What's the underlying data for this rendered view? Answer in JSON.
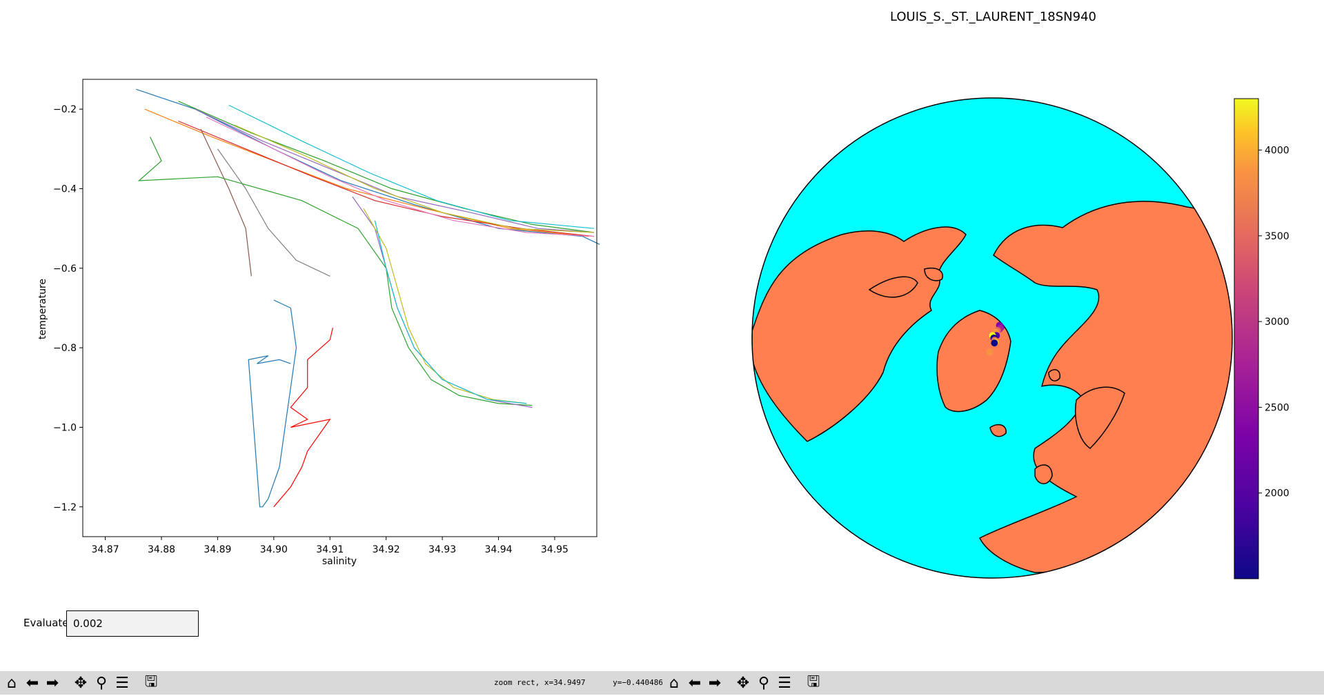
{
  "window": {
    "left_figure": {
      "chart_data": {
        "type": "line",
        "title": "",
        "xlabel": "salinity",
        "ylabel": "temperature",
        "xlim": [
          34.866,
          34.9575
        ],
        "ylim": [
          -1.275,
          -0.125
        ],
        "x_ticks": [
          34.87,
          34.88,
          34.89,
          34.9,
          34.91,
          34.92,
          34.93,
          34.94,
          34.95
        ],
        "y_ticks": [
          -0.2,
          -0.4,
          -0.6,
          -0.8,
          -1.0,
          -1.2
        ],
        "x_tick_labels": [
          "34.87",
          "34.88",
          "34.89",
          "34.90",
          "34.91",
          "34.92",
          "34.93",
          "34.94",
          "34.95"
        ],
        "y_tick_labels": [
          "−0.2",
          "−0.4",
          "−0.6",
          "−0.8",
          "−1.0",
          "−1.2"
        ],
        "grid": false,
        "series": [
          {
            "color": "#1f77b4",
            "x": [
              34.8755,
              34.886,
              34.9,
              34.912,
              34.925,
              34.94,
              34.955,
              34.958
            ],
            "y": [
              -0.15,
              -0.2,
              -0.3,
              -0.38,
              -0.44,
              -0.5,
              -0.52,
              -0.54
            ]
          },
          {
            "color": "#ff7f0e",
            "x": [
              34.877,
              34.889,
              34.9,
              34.913,
              34.927,
              34.942,
              34.956
            ],
            "y": [
              -0.2,
              -0.27,
              -0.33,
              -0.4,
              -0.45,
              -0.5,
              -0.52
            ]
          },
          {
            "color": "#2ca02c",
            "x": [
              34.883,
              34.896,
              34.909,
              34.921,
              34.934,
              34.946,
              34.957
            ],
            "y": [
              -0.18,
              -0.26,
              -0.33,
              -0.4,
              -0.45,
              -0.49,
              -0.51
            ]
          },
          {
            "color": "#d62728",
            "x": [
              34.883,
              34.895,
              34.907,
              34.918,
              34.93,
              34.944,
              34.957
            ],
            "y": [
              -0.23,
              -0.3,
              -0.37,
              -0.43,
              -0.47,
              -0.5,
              -0.52
            ]
          },
          {
            "color": "#9467bd",
            "x": [
              34.886,
              34.898,
              34.91,
              34.922,
              34.935,
              34.947,
              34.957
            ],
            "y": [
              -0.2,
              -0.28,
              -0.35,
              -0.42,
              -0.46,
              -0.5,
              -0.51
            ]
          },
          {
            "color": "#8c564b",
            "x": [
              34.887,
              34.892,
              34.895,
              34.896
            ],
            "y": [
              -0.25,
              -0.4,
              -0.5,
              -0.62
            ]
          },
          {
            "color": "#e377c2",
            "x": [
              34.888,
              34.9,
              34.91,
              34.92,
              34.932,
              34.945,
              34.957
            ],
            "y": [
              -0.22,
              -0.3,
              -0.37,
              -0.43,
              -0.48,
              -0.51,
              -0.52
            ]
          },
          {
            "color": "#7f7f7f",
            "x": [
              34.89,
              34.895,
              34.899,
              34.904,
              34.91
            ],
            "y": [
              -0.3,
              -0.4,
              -0.5,
              -0.58,
              -0.62
            ]
          },
          {
            "color": "#bcbd22",
            "x": [
              34.893,
              34.906,
              34.918,
              34.93,
              34.943,
              34.957
            ],
            "y": [
              -0.24,
              -0.32,
              -0.4,
              -0.46,
              -0.5,
              -0.51
            ]
          },
          {
            "color": "#17becf",
            "x": [
              34.892,
              34.905,
              34.917,
              34.929,
              34.942,
              34.957
            ],
            "y": [
              -0.19,
              -0.28,
              -0.36,
              -0.43,
              -0.48,
              -0.5
            ]
          },
          {
            "color": "#2ca02c",
            "x": [
              34.878,
              34.88,
              34.876,
              34.89,
              34.905,
              34.915,
              34.92,
              34.921,
              34.924,
              34.928,
              34.933,
              34.94,
              34.946
            ],
            "y": [
              -0.27,
              -0.33,
              -0.38,
              -0.37,
              -0.43,
              -0.5,
              -0.6,
              -0.7,
              -0.8,
              -0.88,
              -0.92,
              -0.94,
              -0.945
            ]
          },
          {
            "color": "#9467bd",
            "x": [
              34.914,
              34.918,
              34.92,
              34.922,
              34.925,
              34.93,
              34.938,
              34.946
            ],
            "y": [
              -0.42,
              -0.5,
              -0.6,
              -0.7,
              -0.8,
              -0.88,
              -0.93,
              -0.95
            ]
          },
          {
            "color": "#bcbd22",
            "x": [
              34.916,
              34.92,
              34.922,
              34.924,
              34.927,
              34.932,
              34.939,
              34.945
            ],
            "y": [
              -0.45,
              -0.55,
              -0.65,
              -0.75,
              -0.84,
              -0.9,
              -0.93,
              -0.94
            ]
          },
          {
            "color": "#17becf",
            "x": [
              34.918,
              34.92,
              34.922,
              34.925,
              34.93,
              34.938,
              34.945
            ],
            "y": [
              -0.48,
              -0.6,
              -0.7,
              -0.8,
              -0.88,
              -0.93,
              -0.94
            ]
          },
          {
            "color": "#1f77b4",
            "x": [
              34.9,
              34.903,
              34.904,
              34.903,
              34.902,
              34.901,
              34.9,
              34.899,
              34.898,
              34.8975,
              34.8955,
              34.899,
              34.897,
              34.901,
              34.903
            ],
            "y": [
              -0.68,
              -0.7,
              -0.8,
              -0.9,
              -1.0,
              -1.1,
              -1.14,
              -1.18,
              -1.2,
              -1.2,
              -0.83,
              -0.82,
              -0.84,
              -0.83,
              -0.84
            ]
          },
          {
            "color": "#ff0000",
            "x": [
              34.9105,
              34.91,
              34.906,
              34.906,
              34.903,
              34.906,
              34.903,
              34.91,
              34.908,
              34.906,
              34.905,
              34.903,
              34.9
            ],
            "y": [
              -0.75,
              -0.78,
              -0.83,
              -0.9,
              -0.95,
              -0.98,
              -1.0,
              -0.98,
              -1.02,
              -1.06,
              -1.1,
              -1.15,
              -1.2
            ]
          }
        ]
      },
      "evaluate": {
        "label": "Evaluate",
        "value": "0.002"
      },
      "toolbar": {
        "buttons": [
          "home-icon",
          "back-icon",
          "forward-icon",
          "pan-icon",
          "zoom-icon",
          "configure-subplots-icon",
          "save-icon"
        ],
        "message": "zoom rect, x=34.9497      y=−0.440486"
      }
    },
    "right_figure": {
      "title": "LOUIS_S._ST._LAURENT_18SN940",
      "map": {
        "projection": "north-polar orthographic",
        "ocean_color": "#00ffff",
        "land_color": "#ff7f50",
        "outline_color": "#000000"
      },
      "colorbar": {
        "colormap": "plasma",
        "range": [
          1500,
          4300
        ],
        "ticks": [
          2000,
          2500,
          3000,
          3500,
          4000
        ],
        "tick_labels": [
          "2000",
          "2500",
          "3000",
          "3500",
          "4000"
        ]
      },
      "stations": [
        {
          "lat": 86.5,
          "lon": 150,
          "value": 2350
        },
        {
          "lat": 86.6,
          "lon": 145,
          "value": 2250
        },
        {
          "lat": 86.7,
          "lon": 140,
          "value": 2200
        },
        {
          "lat": 87.0,
          "lon": 140,
          "value": 2450
        },
        {
          "lat": 87.3,
          "lon": 140,
          "value": 2600
        },
        {
          "lat": 87.8,
          "lon": 145,
          "value": 3200
        },
        {
          "lat": 88.3,
          "lon": 150,
          "value": 3500
        },
        {
          "lat": 88.8,
          "lon": 120,
          "value": 1700
        },
        {
          "lat": 89.4,
          "lon": 170,
          "value": 4200
        },
        {
          "lat": 89.6,
          "lon": 90,
          "value": 1600
        },
        {
          "lat": 89.2,
          "lon": 50,
          "value": 3400
        },
        {
          "lat": 88.8,
          "lon": 40,
          "value": 3800
        },
        {
          "lat": 88.7,
          "lon": 25,
          "value": 1600
        },
        {
          "lat": 86.6,
          "lon": -10,
          "value": 3700
        }
      ],
      "toolbar": {
        "buttons": [
          "home-icon",
          "back-icon",
          "forward-icon",
          "pan-icon",
          "zoom-icon",
          "configure-subplots-icon",
          "save-icon"
        ]
      }
    }
  }
}
